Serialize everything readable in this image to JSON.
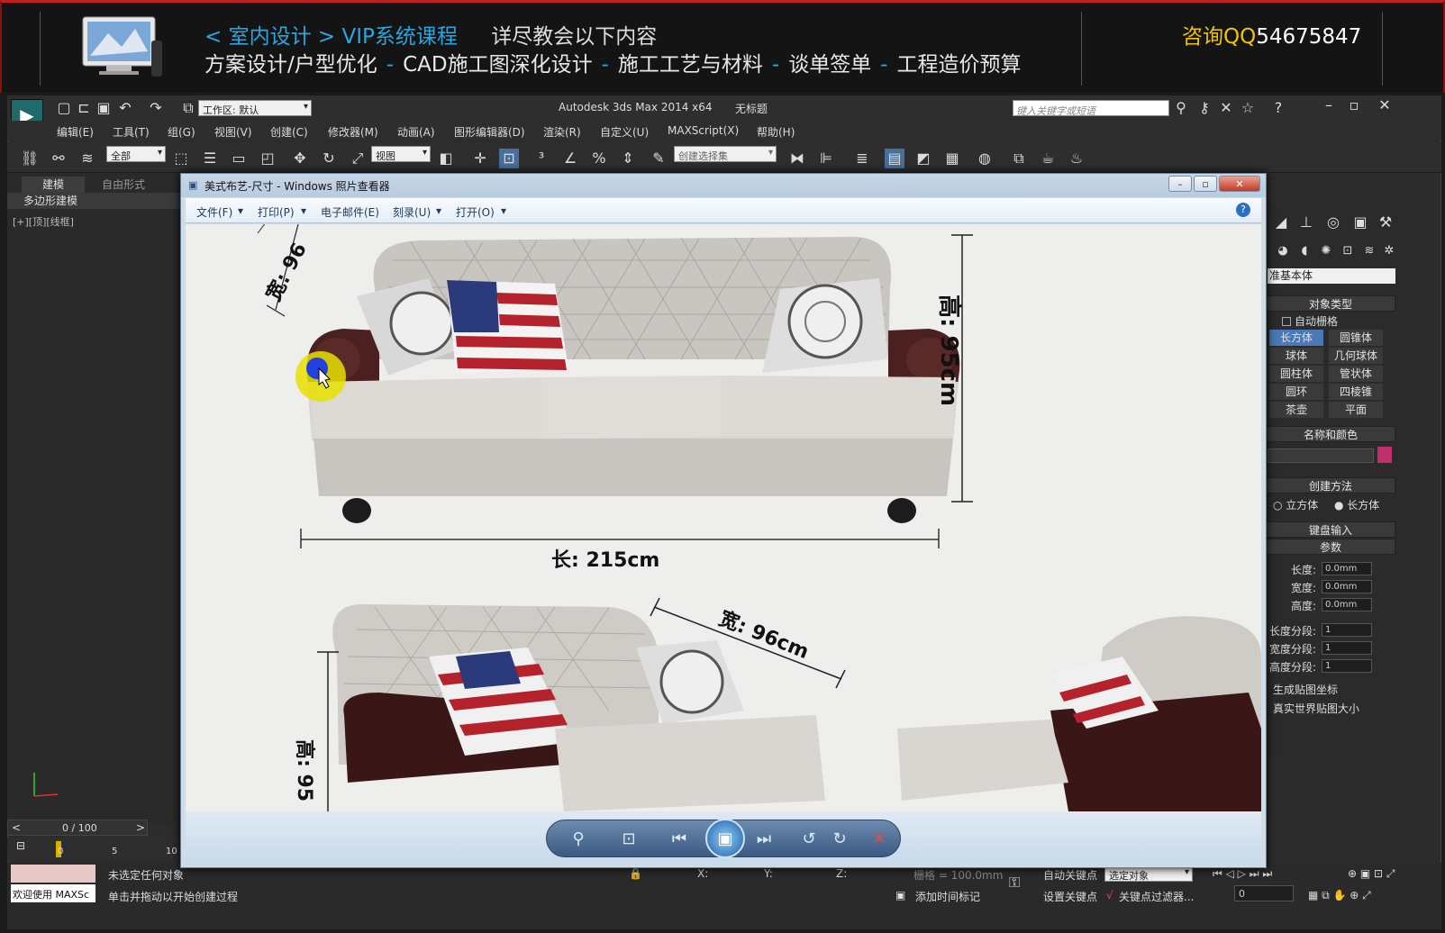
{
  "banner": {
    "breadcrumb_prefix": "<",
    "breadcrumb_1": "室内设计",
    "breadcrumb_sep": ">",
    "breadcrumb_2": "VIP系统课程",
    "subtitle": "详尽教会以下内容",
    "topics": [
      "方案设计/户型优化",
      "CAD施工图深化设计",
      "施工工艺与材料",
      "谈单签单",
      "工程造价预算"
    ],
    "topic_sep": "-",
    "contact_label": "咨询QQ",
    "contact_number": "54675847"
  },
  "max": {
    "title": "Autodesk 3ds Max  2014 x64",
    "doc": "无标题",
    "workspace": "工作区: 默认",
    "search_placeholder": "键入关键字或短语",
    "menus": [
      "编辑(E)",
      "工具(T)",
      "组(G)",
      "视图(V)",
      "创建(C)",
      "修改器(M)",
      "动画(A)",
      "图形编辑器(D)",
      "渲染(R)",
      "自定义(U)",
      "MAXScript(X)",
      "帮助(H)"
    ],
    "toolbar": {
      "filter": "全部",
      "coord": "视图",
      "selset_placeholder": "创建选择集"
    },
    "ribbon_tabs": [
      "建模",
      "自由形式"
    ],
    "ribbon_sub": "多边形建模",
    "viewport_label": "[+][顶][线框]",
    "timeline": {
      "label": "0 / 100",
      "ticks": [
        "0",
        "5",
        "10"
      ]
    },
    "status": {
      "welcome": "欢迎使用  MAXSc",
      "line1": "未选定任何对象",
      "line2": "单击并拖动以开始创建过程",
      "grid": "栅格 = 100.0mm",
      "add_time": "添加时间标记",
      "auto_key": "自动关键点",
      "set_key": "设置关键点",
      "key_filter": "关键点过滤器...",
      "selected": "选定对象",
      "frame": "0",
      "x_label": "X:",
      "y_label": "Y:",
      "z_label": "Z:"
    }
  },
  "command_panel": {
    "category": "准基本体",
    "object_type": "对象类型",
    "auto_grid": "自动栅格",
    "buttons": [
      "长方体",
      "圆锥体",
      "球体",
      "几何球体",
      "圆柱体",
      "管状体",
      "圆环",
      "四棱锥",
      "茶壶",
      "平面"
    ],
    "name_color": "名称和颜色",
    "creation_method": "创建方法",
    "methods": [
      "立方体",
      "长方体"
    ],
    "keyboard_entry": "键盘输入",
    "parameters": "参数",
    "params": [
      {
        "label": "长度:",
        "value": "0.0mm"
      },
      {
        "label": "宽度:",
        "value": "0.0mm"
      },
      {
        "label": "高度:",
        "value": "0.0mm"
      },
      {
        "label": "长度分段:",
        "value": "1"
      },
      {
        "label": "宽度分段:",
        "value": "1"
      },
      {
        "label": "高度分段:",
        "value": "1"
      }
    ],
    "gen_map": "生成贴图坐标",
    "real_world": "真实世界贴图大小"
  },
  "viewer": {
    "title": "美式布艺-尺寸 - Windows 照片查看器",
    "menus": [
      "文件(F)",
      "打印(P)",
      "电子邮件(E)",
      "刻录(U)",
      "打开(O)"
    ],
    "photo_labels": {
      "height_top": "高: 95cm",
      "length": "长: 215cm",
      "width_lower": "宽: 96cm",
      "width_top_partial": "宽: 96",
      "height_lower_partial": "高: 95"
    }
  },
  "colors": {
    "accent_blue": "#2aa6e0",
    "qq_yellow": "#f2c400",
    "banner_red": "#c02020"
  }
}
